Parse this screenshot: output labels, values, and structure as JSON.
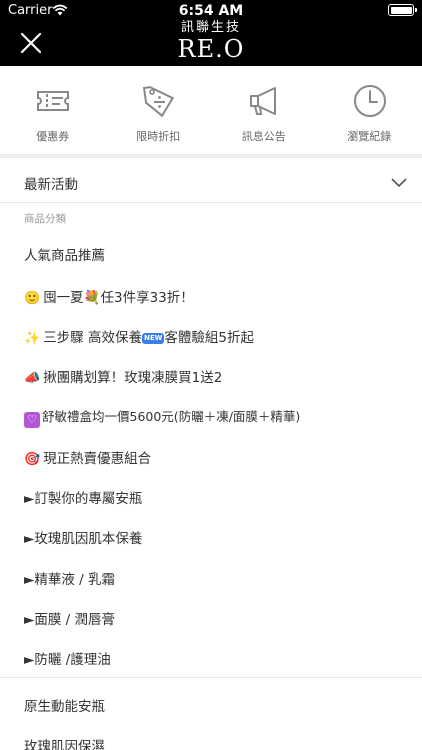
{
  "status_bar": {
    "carrier": "Carrier",
    "time": "6:54 AM"
  },
  "header": {
    "logo_cn": "訊聯生技",
    "logo_en": "RE.O",
    "background": "#000000"
  },
  "quick_actions": [
    {
      "label": "優惠券",
      "icon": "ticket-icon"
    },
    {
      "label": "限時折扣",
      "icon": "discount-tag-icon"
    },
    {
      "label": "訊息公告",
      "icon": "megaphone-icon"
    },
    {
      "label": "瀏覽紀錄",
      "icon": "clock-icon"
    }
  ],
  "menu": {
    "latest": "最新活動",
    "category_header": "商品分類",
    "items": [
      {
        "emoji": "🙂",
        "label": "囤一夏💐任3件享33折！"
      },
      {
        "emoji": "✨",
        "label": "三步驟 高效保養",
        "badge": "NEW",
        "suffix": "客體驗組5折起"
      },
      {
        "emoji": "📣",
        "label": "揪團購划算！玫瑰凍膜買1送2"
      },
      {
        "emoji": "♡",
        "label": "舒敏禮盒均一價5600元(防曬＋凍/面膜＋精華)"
      },
      {
        "emoji": "🎯",
        "label": "現正熱賣優惠組合"
      }
    ],
    "popular": "人氣商品推薦",
    "categories": [
      "►訂製你的專屬安瓶",
      "►玫瑰肌因肌本保養",
      "►精華液 / 乳霜",
      "►面膜 / 潤唇膏",
      "►防曬 /護理油"
    ],
    "bottom_items": [
      "原生動能安瓶",
      "玫瑰肌因保濕"
    ]
  }
}
